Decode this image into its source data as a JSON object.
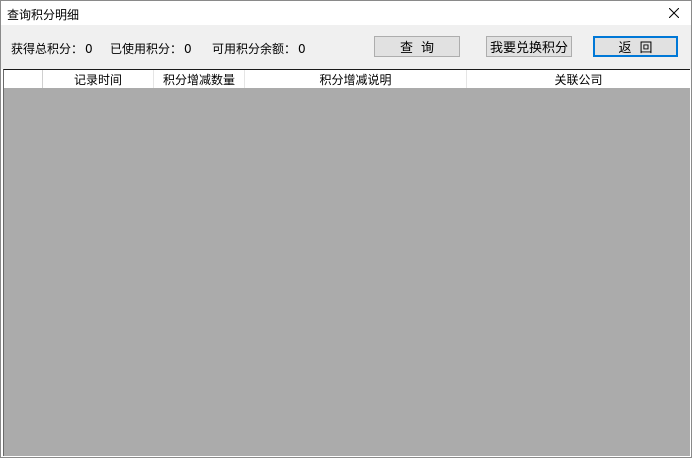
{
  "window": {
    "title": "查询积分明细"
  },
  "stats": {
    "total_label": "获得总积分：",
    "total_value": "0",
    "used_label": "已使用积分：",
    "used_value": "0",
    "available_label": "可用积分余额：",
    "available_value": "0"
  },
  "buttons": {
    "query": "查询",
    "redeem": "我要兑换积分",
    "back": "返回"
  },
  "table": {
    "columns": [
      "",
      "记录时间",
      "积分增减数量",
      "积分增减说明",
      "关联公司"
    ],
    "rows": []
  },
  "icons": {
    "close": "close-icon"
  },
  "colors": {
    "grid_background": "#ababab",
    "toolbar_background": "#f0f0f0",
    "button_background": "#e1e1e1",
    "default_button_border": "#0078d7"
  }
}
